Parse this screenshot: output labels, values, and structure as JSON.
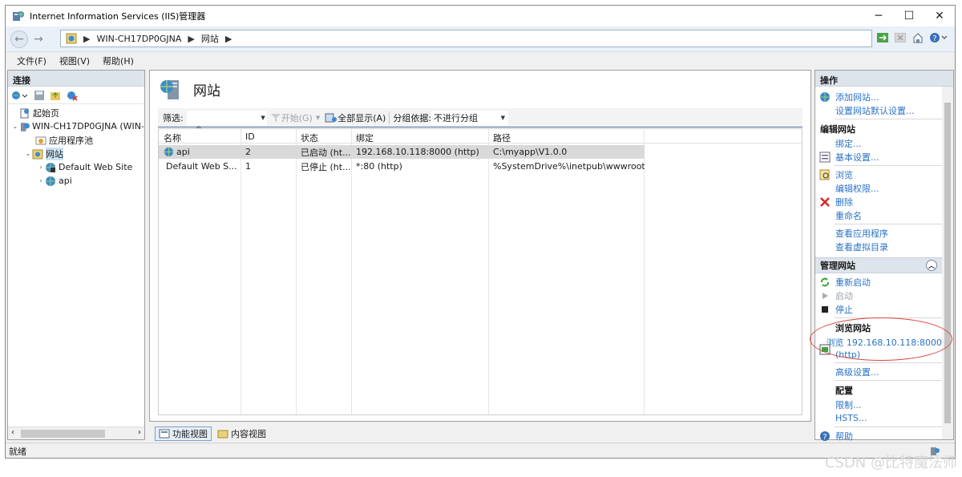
{
  "window": {
    "title": "Internet Information Services (IIS)管理器",
    "controls": {
      "minimize": "─",
      "maximize": "☐",
      "close": "✕"
    }
  },
  "address": {
    "back": "←",
    "forward": "→",
    "breadcrumbs": [
      "WIN-CH17DP0GJNA",
      "网站"
    ],
    "sep": "▶"
  },
  "menu": [
    "文件(F)",
    "视图(V)",
    "帮助(H)"
  ],
  "connections": {
    "title": "连接",
    "tree": [
      {
        "label": "起始页"
      },
      {
        "label": "WIN-CH17DP0GJNA (WIN-"
      },
      {
        "label": "应用程序池"
      },
      {
        "label": "网站"
      },
      {
        "label": "Default Web Site"
      },
      {
        "label": "api"
      }
    ]
  },
  "center": {
    "title": "网站",
    "filter_label": "筛选:",
    "start_label": "开始(G)",
    "show_all_label": "全部显示(A)",
    "group_by_label": "分组依据:",
    "group_by_value": "不进行分组",
    "columns": [
      "名称",
      "ID",
      "状态",
      "绑定",
      "路径"
    ],
    "rows": [
      {
        "name": "api",
        "id": "2",
        "status": "已启动 (ht...",
        "binding": "192.168.10.118:8000 (http)",
        "path": "C:\\myapp\\V1.0.0"
      },
      {
        "name": "Default Web S...",
        "id": "1",
        "status": "已停止 (ht...",
        "binding": "*:80 (http)",
        "path": "%SystemDrive%\\inetpub\\wwwroot"
      }
    ],
    "tabs": [
      "功能视图",
      "内容视图"
    ]
  },
  "actions": {
    "title": "操作",
    "add_site": "添加网站...",
    "site_defaults": "设置网站默认设置...",
    "edit_site_head": "编辑网站",
    "bindings": "绑定...",
    "basic_settings": "基本设置...",
    "browse": "浏览",
    "edit_permissions": "编辑权限...",
    "delete": "删除",
    "rename": "重命名",
    "view_apps": "查看应用程序",
    "view_vdirs": "查看虚拟目录",
    "manage_head": "管理网站",
    "restart": "重新启动",
    "start": "启动",
    "stop": "停止",
    "browse_site_head": "浏览网站",
    "browse_link_1": "浏览 192.168.10.118:8000",
    "browse_link_2": "(http)",
    "advanced": "高级设置...",
    "config_head": "配置",
    "limits": "限制...",
    "hsts": "HSTS...",
    "help": "帮助"
  },
  "status": "就绪",
  "watermark": "CSDN @比特魔法师",
  "colors": {
    "link": "#2a73c5",
    "highlight_circle": "#d9463b",
    "selected_row": "#d9d9d9"
  }
}
